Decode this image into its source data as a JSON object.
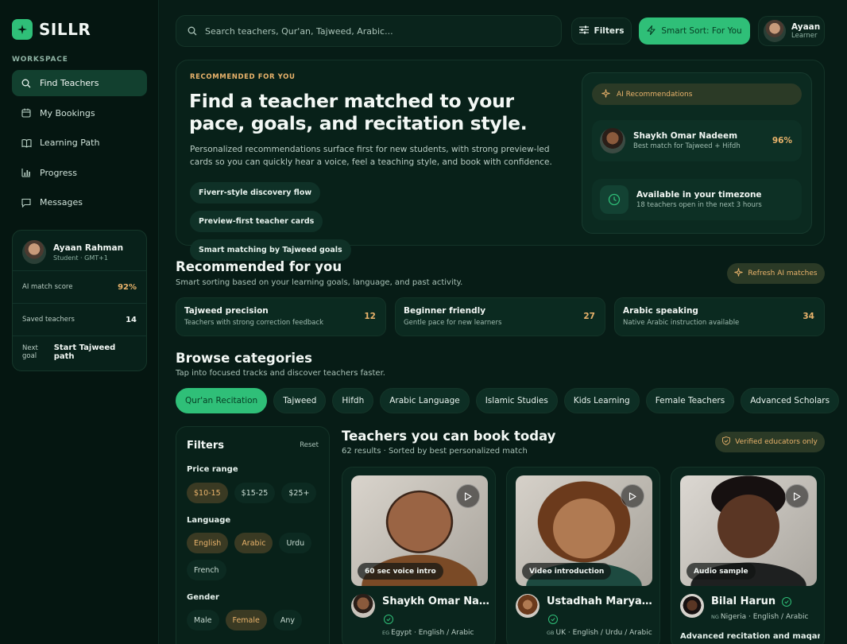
{
  "brand": {
    "name": "SILLR"
  },
  "sidebar": {
    "section_label": "WORKSPACE",
    "items": [
      {
        "label": "Find Teachers",
        "icon": "search-icon"
      },
      {
        "label": "My Bookings",
        "icon": "calendar-icon"
      },
      {
        "label": "Learning Path",
        "icon": "book-icon"
      },
      {
        "label": "Progress",
        "icon": "bar-chart-icon"
      },
      {
        "label": "Messages",
        "icon": "message-icon"
      }
    ],
    "profile": {
      "name": "Ayaan Rahman",
      "sub": "Student · GMT+1",
      "rows": [
        {
          "label": "AI match score",
          "value": "92%"
        },
        {
          "label": "Saved teachers",
          "value": "14"
        },
        {
          "label": "Next goal",
          "value": "Start Tajweed path"
        }
      ]
    }
  },
  "topbar": {
    "search_placeholder": "Search teachers, Qur'an, Tajweed, Arabic...",
    "filters_label": "Filters",
    "smart_sort_label": "Smart Sort: For You",
    "user": {
      "name": "Ayaan",
      "role": "Learner"
    }
  },
  "hero": {
    "eyebrow": "RECOMMENDED FOR YOU",
    "title": "Find a teacher matched to your pace, goals, and recitation style.",
    "description": "Personalized recommendations surface first for new students, with strong preview-led cards so you can quickly hear a voice, feel a teaching style, and book with confidence.",
    "chips": [
      "Fiverr-style discovery flow",
      "Preview-first teacher cards",
      "Smart matching by Tajweed goals"
    ],
    "ai_panel": {
      "pill": "AI Recommendations",
      "match": {
        "name": "Shaykh Omar Nadeem",
        "sub": "Best match for Tajweed + Hifdh",
        "pct": "96%"
      },
      "timezone": {
        "title": "Available in your timezone",
        "sub": "18 teachers open in the next 3 hours"
      }
    }
  },
  "recommended": {
    "title": "Recommended for you",
    "subtitle": "Smart sorting based on your learning goals, language, and past activity.",
    "refresh_label": "Refresh AI matches",
    "cards": [
      {
        "title": "Tajweed precision",
        "sub": "Teachers with strong correction feedback",
        "count": "12"
      },
      {
        "title": "Beginner friendly",
        "sub": "Gentle pace for new learners",
        "count": "27"
      },
      {
        "title": "Arabic speaking",
        "sub": "Native Arabic instruction available",
        "count": "34"
      }
    ]
  },
  "categories": {
    "title": "Browse categories",
    "subtitle": "Tap into focused tracks and discover teachers faster.",
    "items": [
      "Qur'an Recitation",
      "Tajweed",
      "Hifdh",
      "Arabic Language",
      "Islamic Studies",
      "Kids Learning",
      "Female Teachers",
      "Advanced Scholars"
    ]
  },
  "filters": {
    "title": "Filters",
    "reset": "Reset",
    "price_label": "Price range",
    "price": [
      "$10-15",
      "$15-25",
      "$25+"
    ],
    "language_label": "Language",
    "language": [
      "English",
      "Arabic",
      "Urdu",
      "French"
    ],
    "gender_label": "Gender",
    "gender": [
      "Male",
      "Female",
      "Any"
    ]
  },
  "teachers": {
    "title": "Teachers you can book today",
    "subtitle": "62 results · Sorted by best personalized match",
    "verified_label": "Verified educators only",
    "cards": [
      {
        "name": "Shaykh Omar Nadeem",
        "media": "60 sec voice intro",
        "cc": "EG",
        "location": "Egypt · English / Arabic"
      },
      {
        "name": "Ustadhah Maryam Yusuf",
        "media": "Video introduction",
        "cc": "GB",
        "location": "UK · English / Urdu / Arabic"
      },
      {
        "name": "Bilal Harun",
        "media": "Audio sample",
        "cc": "NG",
        "location": "Nigeria · English / Arabic",
        "tagline": "Advanced recitation and maqamat-"
      }
    ]
  },
  "colors": {
    "accent": "#2fbf78",
    "gold": "#e9b36b",
    "bg": "#071c16"
  }
}
